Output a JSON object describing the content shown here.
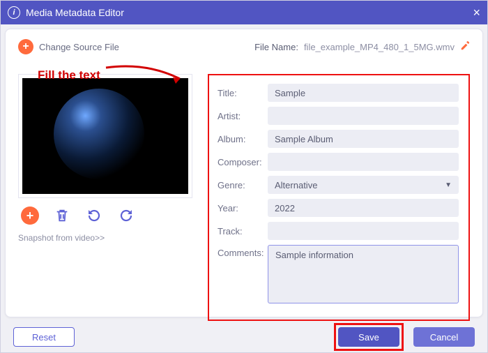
{
  "window": {
    "title": "Media Metadata Editor"
  },
  "header": {
    "change_source": "Change Source File",
    "file_name_label": "File Name:",
    "file_name_value": "file_example_MP4_480_1_5MG.wmv"
  },
  "hint": {
    "text": "Fill the text"
  },
  "snapshot_link": "Snapshot from video>>",
  "fields": {
    "title": {
      "label": "Title:",
      "value": "Sample"
    },
    "artist": {
      "label": "Artist:",
      "value": ""
    },
    "album": {
      "label": "Album:",
      "value": "Sample Album"
    },
    "composer": {
      "label": "Composer:",
      "value": ""
    },
    "genre": {
      "label": "Genre:",
      "value": "Alternative"
    },
    "year": {
      "label": "Year:",
      "value": "2022"
    },
    "track": {
      "label": "Track:",
      "value": ""
    },
    "comments": {
      "label": "Comments:",
      "value": "Sample information"
    }
  },
  "buttons": {
    "reset": "Reset",
    "save": "Save",
    "cancel": "Cancel"
  },
  "colors": {
    "accent": "#5155c2",
    "warn_orange": "#ff6a3c",
    "highlight_red": "#e11"
  }
}
